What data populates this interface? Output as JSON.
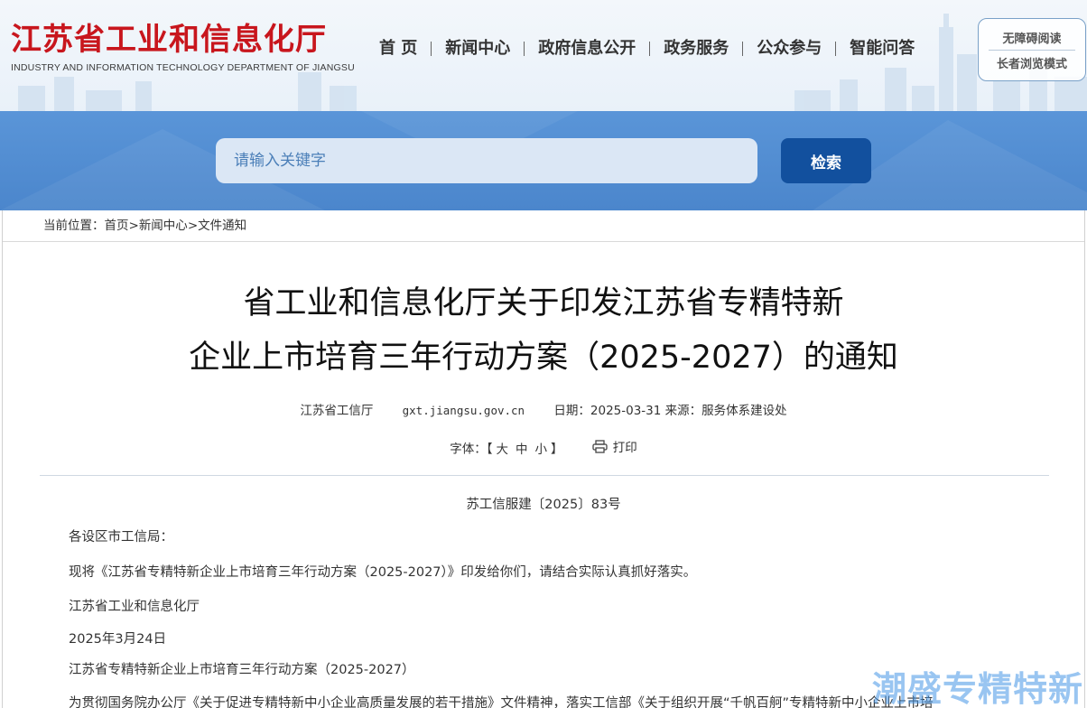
{
  "header": {
    "logo_title": "江苏省工业和信息化厅",
    "logo_subtitle": "INDUSTRY AND INFORMATION TECHNOLOGY DEPARTMENT OF JIANGSU",
    "nav": [
      "首 页",
      "新闻中心",
      "政府信息公开",
      "政务服务",
      "公众参与",
      "智能问答"
    ],
    "accessibility": {
      "reading": "无障碍阅读",
      "elder_mode": "长者浏览模式"
    }
  },
  "search": {
    "placeholder": "请输入关键字",
    "button": "检索"
  },
  "breadcrumb": {
    "prefix": "当前位置：",
    "items": [
      "首页",
      "新闻中心",
      "文件通知"
    ],
    "separator": ">"
  },
  "article": {
    "title_line1": "省工业和信息化厅关于印发江苏省专精特新",
    "title_line2": "企业上市培育三年行动方案（2025-2027）的通知",
    "meta": {
      "site": "江苏省工信厅",
      "url": "gxt.jiangsu.gov.cn",
      "date_label": "日期：",
      "date": "2025-03-31",
      "source_label": "来源：",
      "source": "服务体系建设处"
    },
    "tools": {
      "font_label": "字体：",
      "bracket_open": "【",
      "large": "大",
      "medium": "中",
      "small": "小",
      "bracket_close": "】",
      "print": "打印"
    },
    "doc_number": "苏工信服建〔2025〕83号",
    "paragraphs": [
      "各设区市工信局：",
      "现将《江苏省专精特新企业上市培育三年行动方案（2025-2027）》印发给你们，请结合实际认真抓好落实。",
      "江苏省工业和信息化厅",
      "2025年3月24日",
      "江苏省专精特新企业上市培育三年行动方案（2025-2027）",
      "为贯彻国务院办公厅《关于促进专精特新中小企业高质量发展的若干措施》文件精神，落实工信部《关于组织开展“千帆百舸”专精特新中小企业上市培"
    ]
  },
  "watermark": "潮盛专精特新",
  "colors": {
    "brand_red": "#c8161d",
    "search_band": "#4f8bd0",
    "search_button": "#12509e"
  }
}
